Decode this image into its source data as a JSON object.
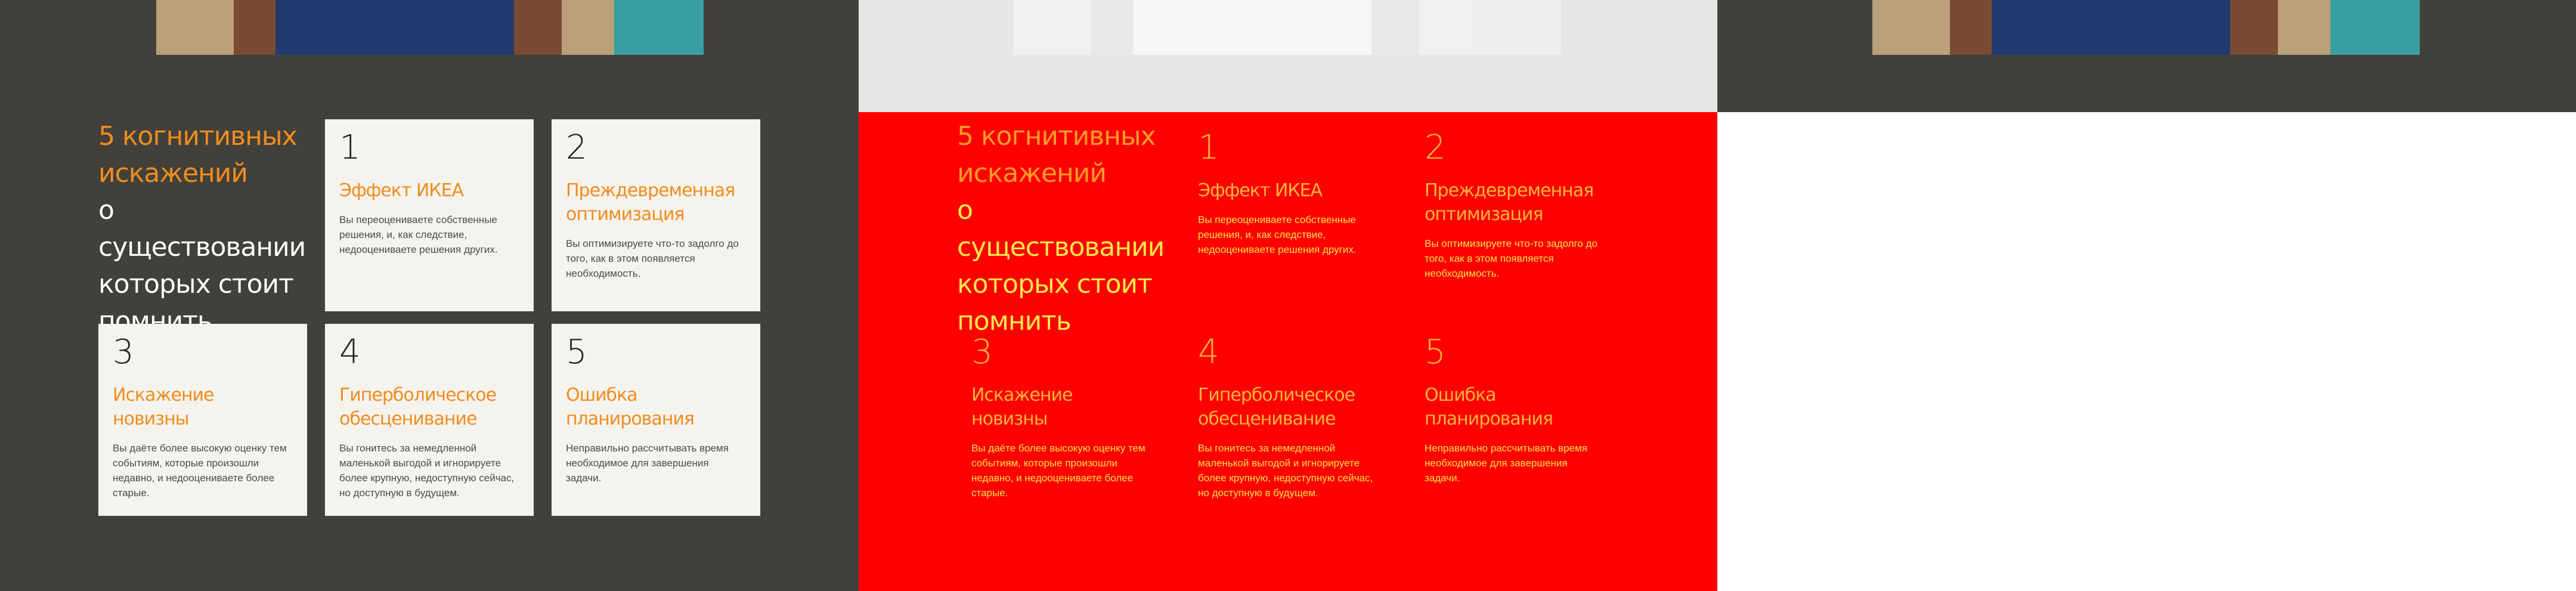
{
  "title": {
    "accent": "5 когнитивных искажений",
    "rest": "о существовании которых стоит помнить"
  },
  "cards": [
    {
      "num": "1",
      "title": "Эффект ИКЕА",
      "text": "Вы переоцениваете собственные решения, и, как следствие, недооцениваете решения других."
    },
    {
      "num": "2",
      "title": "Преждевременная оптимизация",
      "text": "Вы оптимизируете что-то задолго до того, как в этом появляется необходимость."
    },
    {
      "num": "3",
      "title": "Искажение новизны",
      "text": "Вы даёте более высокую оценку тем событиям, которые произошли недавно, и недооцениваете более старые."
    },
    {
      "num": "4",
      "title": "Гиперболическое обесценивание",
      "text": "Вы гонитесь за немедленной маленькой выгодой и игнорируете более крупную, недоступную сейчас, но доступную в будущем."
    },
    {
      "num": "5",
      "title": "Ошибка планирования",
      "text": "Неправильно рассчитывать время необходимое для завершения задачи."
    }
  ],
  "colors": {
    "accent": "#f08c1e",
    "dark_bg": "#42403b",
    "card_bg": "#f5f3ee",
    "red_bg": "#ff0000"
  }
}
